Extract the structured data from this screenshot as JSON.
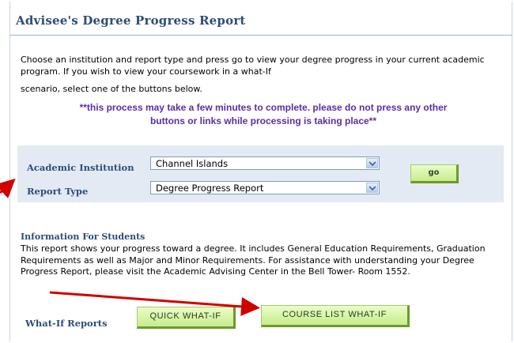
{
  "page": {
    "title": "Advisee's Degree Progress Report",
    "intro_text": "Choose an institution and report type and press go to view your degree progress in your current academic program. If you wish to view your coursework in a what-If",
    "intro_text_2": "scenario, select one of the buttons below.",
    "warning_line_1": "**this process may take a few minutes to complete. please do not press any other",
    "warning_line_2": "buttons or links while processing is taking place**"
  },
  "criteria": {
    "institution_label": "Academic Institution",
    "institution_value": "Channel Islands",
    "report_type_label": "Report Type",
    "report_type_value": "Degree Progress Report",
    "go_label": "go"
  },
  "info": {
    "heading": "Information For Students",
    "body": "This report shows your progress toward a degree. It includes General Education Requirements, Graduation Requirements as well as Major and Minor Requirements. For assistance with understanding your Degree Progress Report, please visit the Academic Advising Center in the Bell Tower- Room 1552."
  },
  "whatif": {
    "label": "What-If Reports",
    "quick_button": "QUICK WHAT-IF",
    "course_list_button": "COURSE LIST WHAT-IF"
  },
  "colors": {
    "heading_blue": "#2e4c78",
    "warning_purple": "#5a2ea0",
    "panel_bg": "#e3eaf4",
    "button_green": "#c8ec8e",
    "arrow_red": "#d00000"
  },
  "icons": {
    "dropdown": "chevron-down-icon",
    "annotation": "red-arrow"
  }
}
